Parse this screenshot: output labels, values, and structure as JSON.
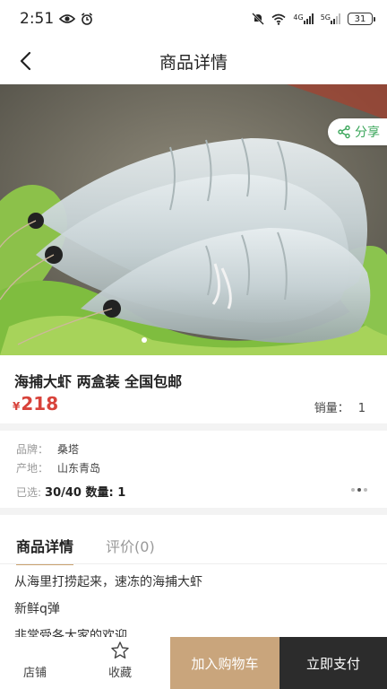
{
  "status": {
    "time": "2:51",
    "battery": "31",
    "net1": "4G",
    "net2": "5G"
  },
  "nav": {
    "title": "商品详情"
  },
  "hero": {
    "share_label": "分享"
  },
  "product": {
    "title": "海捕大虾 两盒装 全国包邮",
    "currency": "¥",
    "price": "218",
    "sales_label": "销量：",
    "sales_value": "1"
  },
  "spec": {
    "brand_label": "品牌：",
    "brand": "桑塔",
    "origin_label": "产地：",
    "origin": "山东青岛",
    "selected_label": "已选:",
    "selected_value": "30/40 数量: 1"
  },
  "detail": {
    "tabs": [
      {
        "label": "商品详情"
      },
      {
        "label": "评价(0)"
      }
    ],
    "lines": [
      "从海里打捞起来，速冻的海捕大虾",
      "新鲜q弹",
      "非常受各大家的欢迎"
    ]
  },
  "bottom": {
    "store": "店铺",
    "favorite": "收藏",
    "add_cart": "加入购物车",
    "buy_now": "立即支付"
  }
}
